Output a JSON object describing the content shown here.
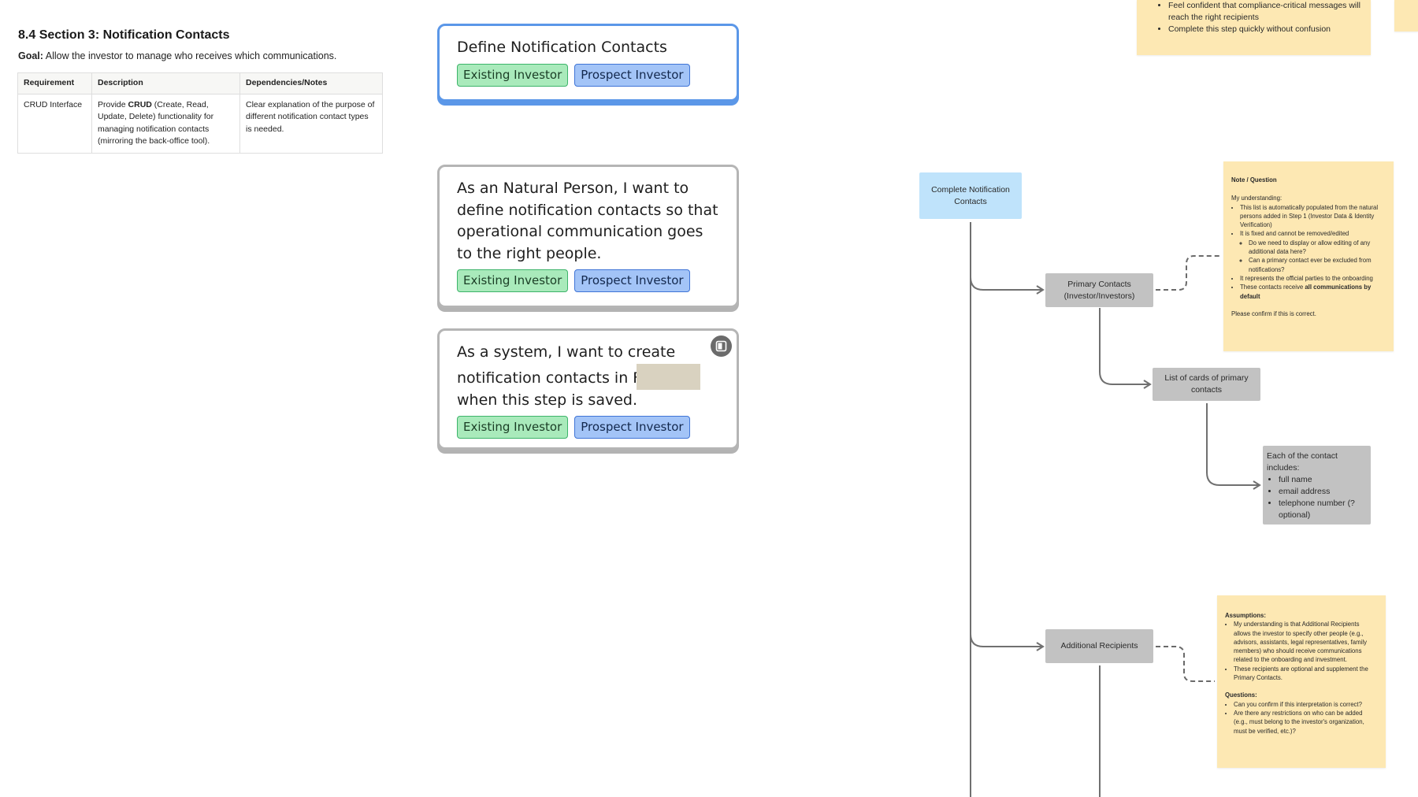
{
  "spec": {
    "title": "8.4 Section 3: Notification Contacts",
    "goal_label": "Goal:",
    "goal_text": "Allow the investor to manage who receives which communications.",
    "table": {
      "headers": [
        "Requirement",
        "Description",
        "Dependencies/Notes"
      ],
      "row": {
        "requirement": "CRUD Interface",
        "desc_pre": "Provide ",
        "desc_bold": "CRUD",
        "desc_post": " (Create, Read, Update, Delete) functionality for managing notification contacts (mirroring the back-office tool).",
        "notes": "Clear explanation of the purpose of different notification contact types is needed."
      }
    }
  },
  "cards": [
    {
      "text": "Define Notification Contacts",
      "tags": [
        "Existing Investor",
        "Prospect Investor"
      ]
    },
    {
      "text": "As an Natural Person, I want to define notification contacts so that operational communication goes to the right people.",
      "tags": [
        "Existing Investor",
        "Prospect Investor"
      ]
    },
    {
      "text_pre": "As a system, I want to create notification contacts in F",
      "text_post": "when this step is saved.",
      "tags": [
        "Existing Investor",
        "Prospect Investor"
      ]
    }
  ],
  "tag_colors": {
    "existing": "#a9eabb",
    "prospect": "#a3c4f7"
  },
  "flow": {
    "start": "Complete Notification Contacts",
    "primary": "Primary Contacts (Investor/Investors)",
    "list_cards": "List of cards of primary contacts",
    "contact_intro": "Each of the contact includes:",
    "contact_fields": [
      "full name",
      "email address",
      "telephone number (? optional)"
    ],
    "additional": "Additional Recipients"
  },
  "sticky_top": {
    "items": [
      "Feel confident that compliance-critical messages will reach the right recipients",
      "Complete this step quickly without confusion"
    ]
  },
  "sticky_note": {
    "title": "Note / Question",
    "intro": "My understanding:",
    "b1": "This list is automatically populated from the natural persons added in Step 1 (Investor Data & Identity Verification)",
    "b2": "It is fixed and cannot be removed/edited",
    "b2a": "Do we need to display or allow editing of any additional data here?",
    "b2b": "Can a primary contact ever be excluded from notifications?",
    "b3": "It represents the official parties to the onboarding",
    "b4_pre": "These contacts receive ",
    "b4_bold": "all communications by default",
    "confirm": "Please confirm if this is correct."
  },
  "sticky_assume": {
    "title1": "Assumptions:",
    "a1": "My understanding is that Additional Recipients allows the investor to specify other people (e.g., advisors, assistants, legal representatives, family members) who should receive communications related to the onboarding and investment.",
    "a2": "These recipients are optional and supplement the Primary Contacts.",
    "title2": "Questions:",
    "q1": "Can you confirm if this interpretation is correct?",
    "q2": "Are there any restrictions on who can be added (e.g., must belong to the investor's organization, must be verified, etc.)?"
  }
}
